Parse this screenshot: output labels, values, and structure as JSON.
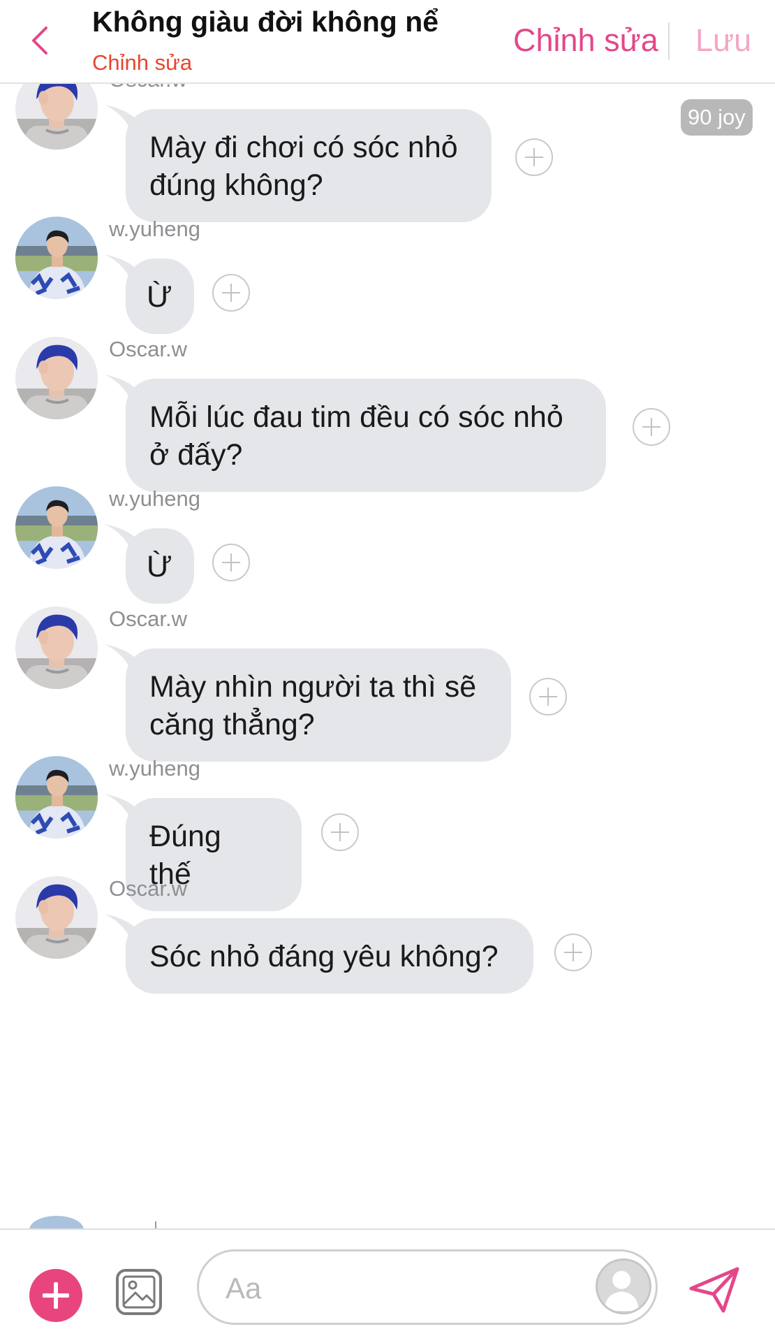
{
  "header": {
    "title": "Không giàu đời không nể",
    "subtitle": "Chỉnh sửa",
    "edit_label": "Chỉnh sửa",
    "save_label": "Lưu",
    "accent_color": "#e34789"
  },
  "badge": {
    "label": "90 joy"
  },
  "messages": [
    {
      "sender": "Oscar.w",
      "text": "Mày đi chơi có sóc nhỏ đúng không?",
      "avatar": "oscar-avatar"
    },
    {
      "sender": "w.yuheng",
      "text": "Ừ",
      "avatar": "yuheng-avatar"
    },
    {
      "sender": "Oscar.w",
      "text": "Mỗi lúc đau tim đều có sóc nhỏ ở đấy?",
      "avatar": "oscar-avatar"
    },
    {
      "sender": "w.yuheng",
      "text": "Ừ",
      "avatar": "yuheng-avatar"
    },
    {
      "sender": "Oscar.w",
      "text": "Mày nhìn người ta thì sẽ căng thẳng?",
      "avatar": "oscar-avatar"
    },
    {
      "sender": "w.yuheng",
      "text": "Đúng thế",
      "avatar": "yuheng-avatar"
    },
    {
      "sender": "Oscar.w",
      "text": "Sóc nhỏ đáng yêu không?",
      "avatar": "oscar-avatar"
    }
  ],
  "composer": {
    "placeholder": "Aa",
    "add_icon": "plus-icon",
    "image_icon": "image-icon",
    "send_icon": "send-icon"
  }
}
